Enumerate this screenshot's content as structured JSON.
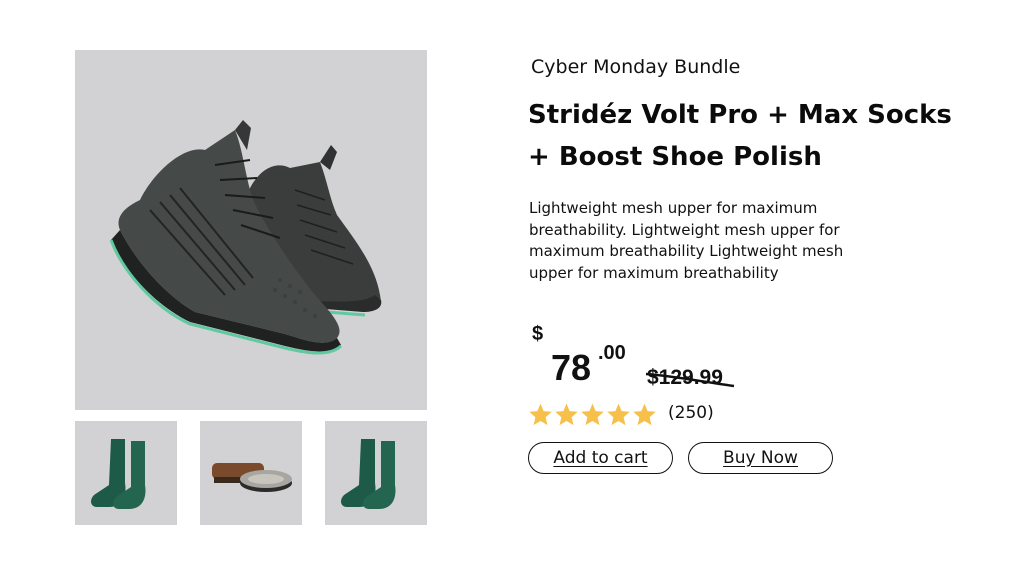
{
  "product": {
    "eyebrow": "Cyber Monday Bundle",
    "title": "Stridéz Volt Pro + Max Socks + Boost Shoe Polish",
    "description": "Lightweight mesh upper for maximum breathability. Lightweight mesh upper for maximum breathability Lightweight mesh upper for maximum breathability"
  },
  "price": {
    "currency": "$",
    "whole": "78",
    "fraction": ".00",
    "original": "$129.99"
  },
  "rating": {
    "stars": 5,
    "count": "(250)",
    "star_color": "#f7c04a"
  },
  "actions": {
    "add_to_cart": "Add to cart",
    "buy_now": "Buy Now"
  },
  "gallery": {
    "main": "sneakers-image",
    "thumbnails": [
      "socks-image",
      "shoe-polish-kit-image",
      "socks-image"
    ]
  },
  "colors": {
    "image_background": "#d2d2d4",
    "sock_green": "#1d5a47",
    "sole_accent": "#5fc9a0"
  }
}
